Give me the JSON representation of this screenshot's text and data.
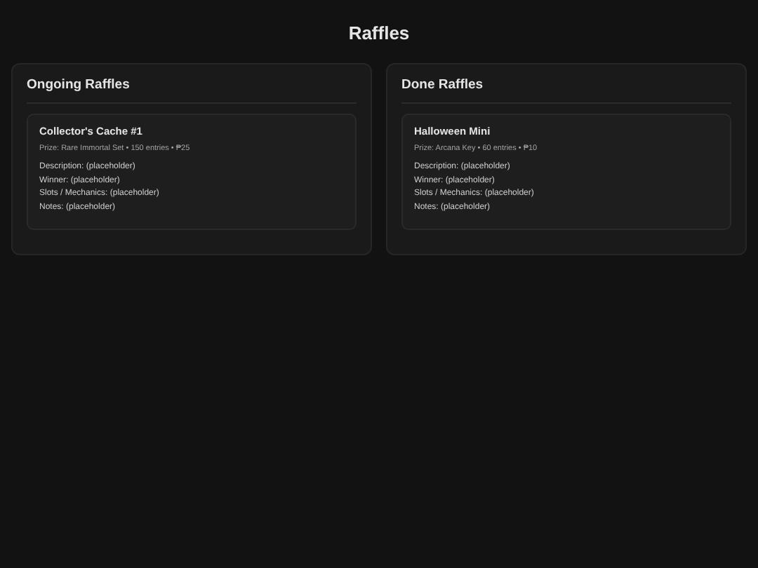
{
  "title": "Raffles",
  "sections": [
    {
      "heading": "Ongoing Raffles",
      "raffles": [
        {
          "name": "Collector's Cache #1",
          "meta": "Prize: Rare Immortal Set • 150 entries • ₱25",
          "details": [
            "Description: (placeholder)",
            "Winner: (placeholder)",
            "Slots / Mechanics: (placeholder)",
            "Notes: (placeholder)"
          ]
        }
      ]
    },
    {
      "heading": "Done Raffles",
      "raffles": [
        {
          "name": "Halloween Mini",
          "meta": "Prize: Arcana Key • 60 entries • ₱10",
          "details": [
            "Description: (placeholder)",
            "Winner: (placeholder)",
            "Slots / Mechanics: (placeholder)",
            "Notes: (placeholder)"
          ]
        }
      ]
    }
  ]
}
